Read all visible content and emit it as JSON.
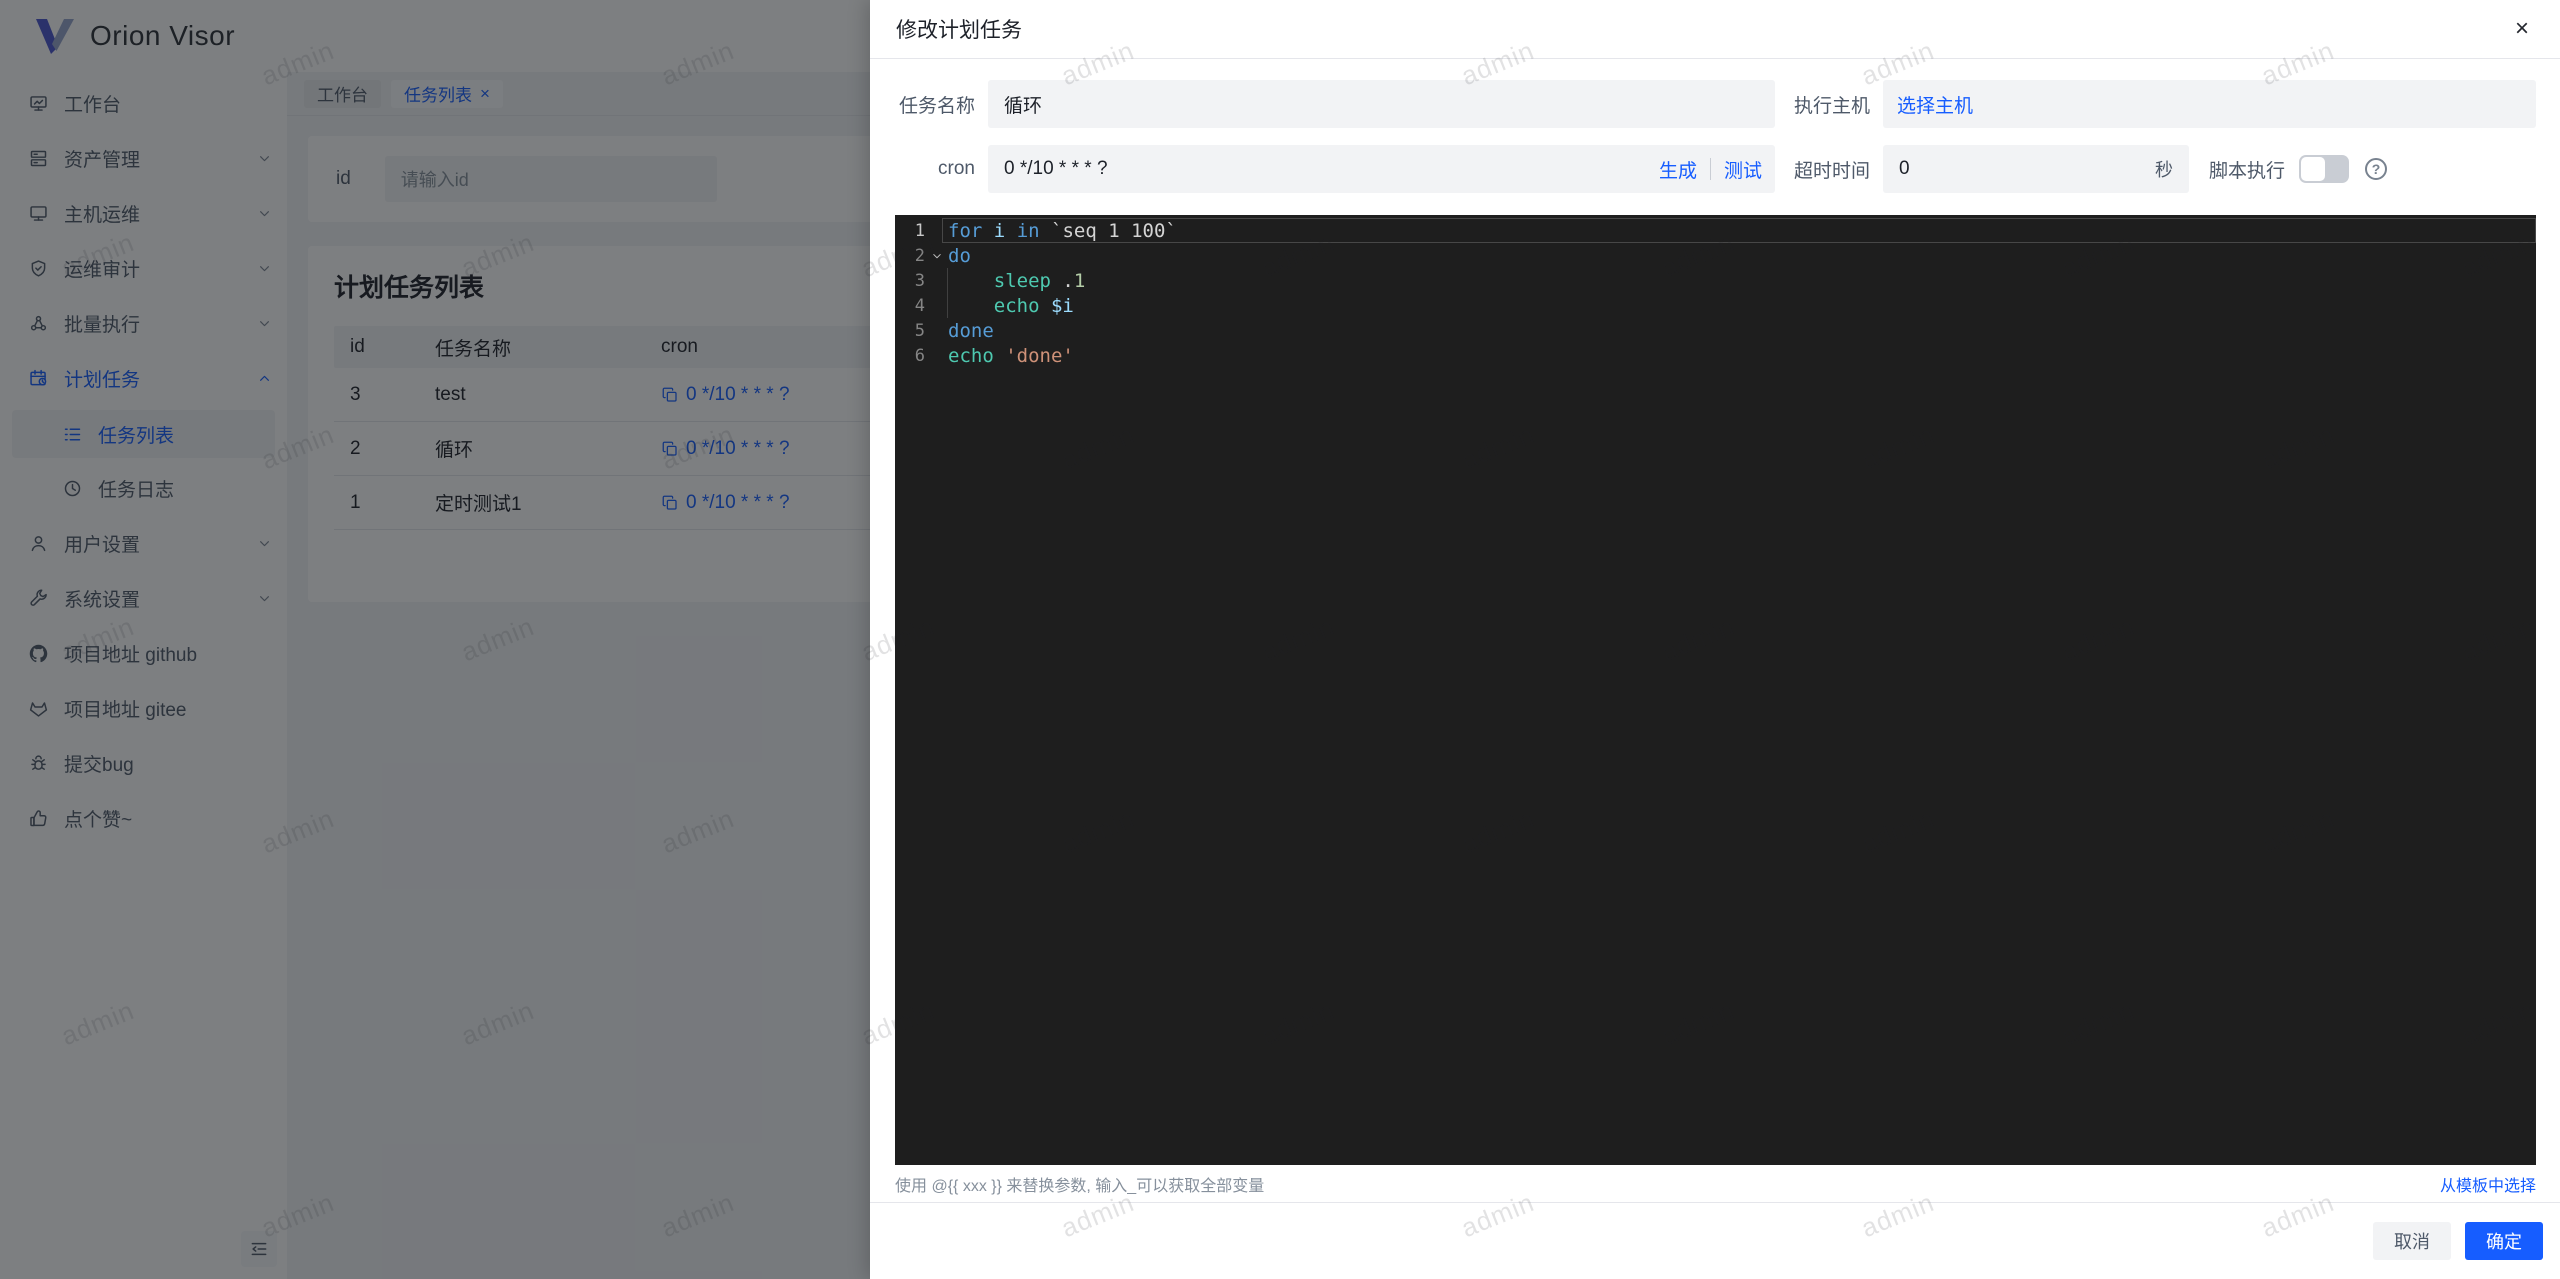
{
  "app": {
    "brand": "Orion Visor"
  },
  "watermark": {
    "text": "admin"
  },
  "colors": {
    "accent": "#165dff",
    "editor_bg": "#1e1e1e",
    "token_keyword": "#569cd6",
    "token_function": "#4ec9b0",
    "token_number": "#b5cea8",
    "token_string": "#ce9178",
    "token_variable": "#9cdcfe",
    "switch_off": "#c9cdd4",
    "input_bg": "#f2f3f5"
  },
  "sidebar": {
    "items": [
      {
        "key": "workbench",
        "label": "工作台",
        "icon": "dashboard-icon"
      },
      {
        "key": "assets",
        "label": "资产管理",
        "icon": "asset-icon",
        "chevron": "down"
      },
      {
        "key": "host-ops",
        "label": "主机运维",
        "icon": "host-icon",
        "chevron": "down"
      },
      {
        "key": "audit",
        "label": "运维审计",
        "icon": "audit-icon",
        "chevron": "down"
      },
      {
        "key": "batch-exec",
        "label": "批量执行",
        "icon": "batch-icon",
        "chevron": "down"
      },
      {
        "key": "schedule",
        "label": "计划任务",
        "icon": "schedule-icon",
        "chevron": "up",
        "active": true
      },
      {
        "key": "task-list",
        "label": "任务列表",
        "icon": "list-icon",
        "indent": true,
        "selected": true
      },
      {
        "key": "task-log",
        "label": "任务日志",
        "icon": "log-icon",
        "indent": true
      },
      {
        "key": "user-settings",
        "label": "用户设置",
        "icon": "user-icon",
        "chevron": "down"
      },
      {
        "key": "system-settings",
        "label": "系统设置",
        "icon": "settings-icon",
        "chevron": "down"
      },
      {
        "key": "github",
        "label": "项目地址 github",
        "icon": "github-icon"
      },
      {
        "key": "gitee",
        "label": "项目地址 gitee",
        "icon": "gitee-icon"
      },
      {
        "key": "bug",
        "label": "提交bug",
        "icon": "bug-icon"
      },
      {
        "key": "like",
        "label": "点个赞~",
        "icon": "like-icon"
      }
    ]
  },
  "tabs": [
    {
      "key": "workbench",
      "label": "工作台"
    },
    {
      "key": "task-list",
      "label": "任务列表",
      "active": true,
      "closable": true,
      "close_glyph": "×"
    }
  ],
  "filter": {
    "id_label": "id",
    "id_placeholder": "请输入id"
  },
  "task_table": {
    "title": "计划任务列表",
    "columns": [
      "id",
      "任务名称",
      "cron"
    ],
    "rows": [
      {
        "id": "3",
        "name": "test",
        "cron": "0 */10 * * * ?"
      },
      {
        "id": "2",
        "name": "循环",
        "cron": "0 */10 * * * ?"
      },
      {
        "id": "1",
        "name": "定时测试1",
        "cron": "0 */10 * * * ?"
      }
    ]
  },
  "modal": {
    "title": "修改计划任务",
    "close": "×",
    "fields": {
      "name_label": "任务名称",
      "name_value": "循环",
      "host_label": "执行主机",
      "host_action": "选择主机",
      "cron_label": "cron",
      "cron_value": "0 */10 * * * ?",
      "generate": "生成",
      "test": "测试",
      "timeout_label": "超时时间",
      "timeout_value": "0",
      "timeout_unit": "秒",
      "script_label": "脚本执行",
      "help_glyph": "?"
    },
    "editor": {
      "lines": [
        {
          "no": "1",
          "current": true,
          "tokens": [
            [
              "kw",
              "for"
            ],
            [
              "def",
              " "
            ],
            [
              "var",
              "i"
            ],
            [
              "def",
              " "
            ],
            [
              "kw",
              "in"
            ],
            [
              "def",
              " `seq 1 100`"
            ]
          ]
        },
        {
          "no": "2",
          "fold": true,
          "tokens": [
            [
              "kw",
              "do"
            ]
          ]
        },
        {
          "no": "3",
          "guide": true,
          "tokens": [
            [
              "def",
              "    "
            ],
            [
              "fn",
              "sleep"
            ],
            [
              "def",
              " ."
            ],
            [
              "num",
              "1"
            ]
          ]
        },
        {
          "no": "4",
          "guide": true,
          "tokens": [
            [
              "def",
              "    "
            ],
            [
              "fn",
              "echo"
            ],
            [
              "def",
              " "
            ],
            [
              "var",
              "$i"
            ]
          ]
        },
        {
          "no": "5",
          "tokens": [
            [
              "kw",
              "done"
            ]
          ]
        },
        {
          "no": "6",
          "tokens": [
            [
              "fn",
              "echo"
            ],
            [
              "def",
              " "
            ],
            [
              "str",
              "'done'"
            ]
          ]
        }
      ]
    },
    "hint": "使用 @{{ xxx }} 来替换参数, 输入_可以获取全部变量",
    "template_link": "从模板中选择",
    "cancel": "取消",
    "ok": "确定"
  }
}
